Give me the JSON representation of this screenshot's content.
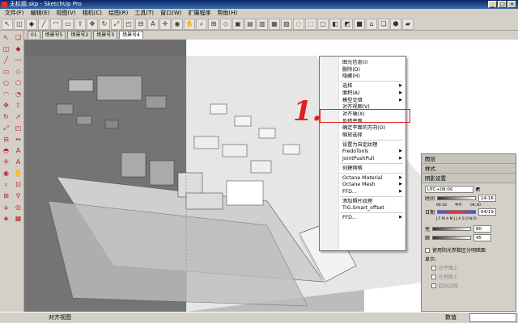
{
  "window": {
    "title": "无标题.skp - SketchUp Pro",
    "min": "_",
    "max": "□",
    "close": "×"
  },
  "menu": [
    "文件(F)",
    "编辑(E)",
    "视图(V)",
    "相机(C)",
    "绘图(R)",
    "工具(T)",
    "窗口(W)",
    "扩展程序",
    "帮助(H)"
  ],
  "scene_tabs": [
    "01",
    "场景号5",
    "场景号2",
    "场景号3",
    "场景号4"
  ],
  "active_scene": 4,
  "context_menu": {
    "items": [
      {
        "label": "图元信息(I)",
        "sub": false
      },
      {
        "label": "删除(D)",
        "sub": false
      },
      {
        "label": "隐藏(H)",
        "sub": false
      },
      {
        "sep": true
      },
      {
        "label": "选择",
        "sub": true
      },
      {
        "label": "面积(A)",
        "sub": true
      },
      {
        "label": "模型交错",
        "sub": true
      },
      {
        "label": "对齐视图(V)",
        "sub": false,
        "highlight": true
      },
      {
        "label": "对齐轴(X)",
        "sub": false
      },
      {
        "label": "反转平面",
        "sub": false
      },
      {
        "label": "确定平面的方向(O)",
        "sub": false
      },
      {
        "label": "缩放选择",
        "sub": false
      },
      {
        "sep": true
      },
      {
        "label": "设置为自定纹理",
        "sub": false
      },
      {
        "label": "FredoTools",
        "sub": true
      },
      {
        "label": "JointPushPull",
        "sub": true
      },
      {
        "sep": true
      },
      {
        "label": "创建网格",
        "sub": false
      },
      {
        "sep": true
      },
      {
        "label": "Octane Material",
        "sub": true
      },
      {
        "label": "Octane Mesh",
        "sub": true
      },
      {
        "label": "FFD...",
        "sub": true
      },
      {
        "sep": true
      },
      {
        "label": "添加照片纹理",
        "sub": false
      },
      {
        "label": "TIG.Smart_offset",
        "sub": false
      },
      {
        "sep": true
      },
      {
        "label": "FFD...",
        "sub": true
      }
    ]
  },
  "annotation": "1.",
  "trays": {
    "panel1": "图层",
    "panel2": "样式",
    "shadow": {
      "title": "阴影设置",
      "utc": "UTC+08:00",
      "time_label": "时间",
      "time_value": "14:16",
      "time_ticks": [
        "06:30",
        "中午",
        "04:30"
      ],
      "date_label": "日期",
      "date_value": "04/19",
      "months": "J F M A M J J A S O N D",
      "light_label": "亮",
      "light_value": "80",
      "dark_label": "暗",
      "dark_value": "45",
      "use_sun_label": "使用阳光参数区分明暗面",
      "display_label": "显示:",
      "opt1": "在平面上",
      "opt2": "在地面上",
      "opt3": "起始边线"
    }
  },
  "status": {
    "left": "对齐视图",
    "measure_label": "数值"
  },
  "colors": {
    "highlight": "#e02020",
    "titlebar": "#0a246a"
  }
}
